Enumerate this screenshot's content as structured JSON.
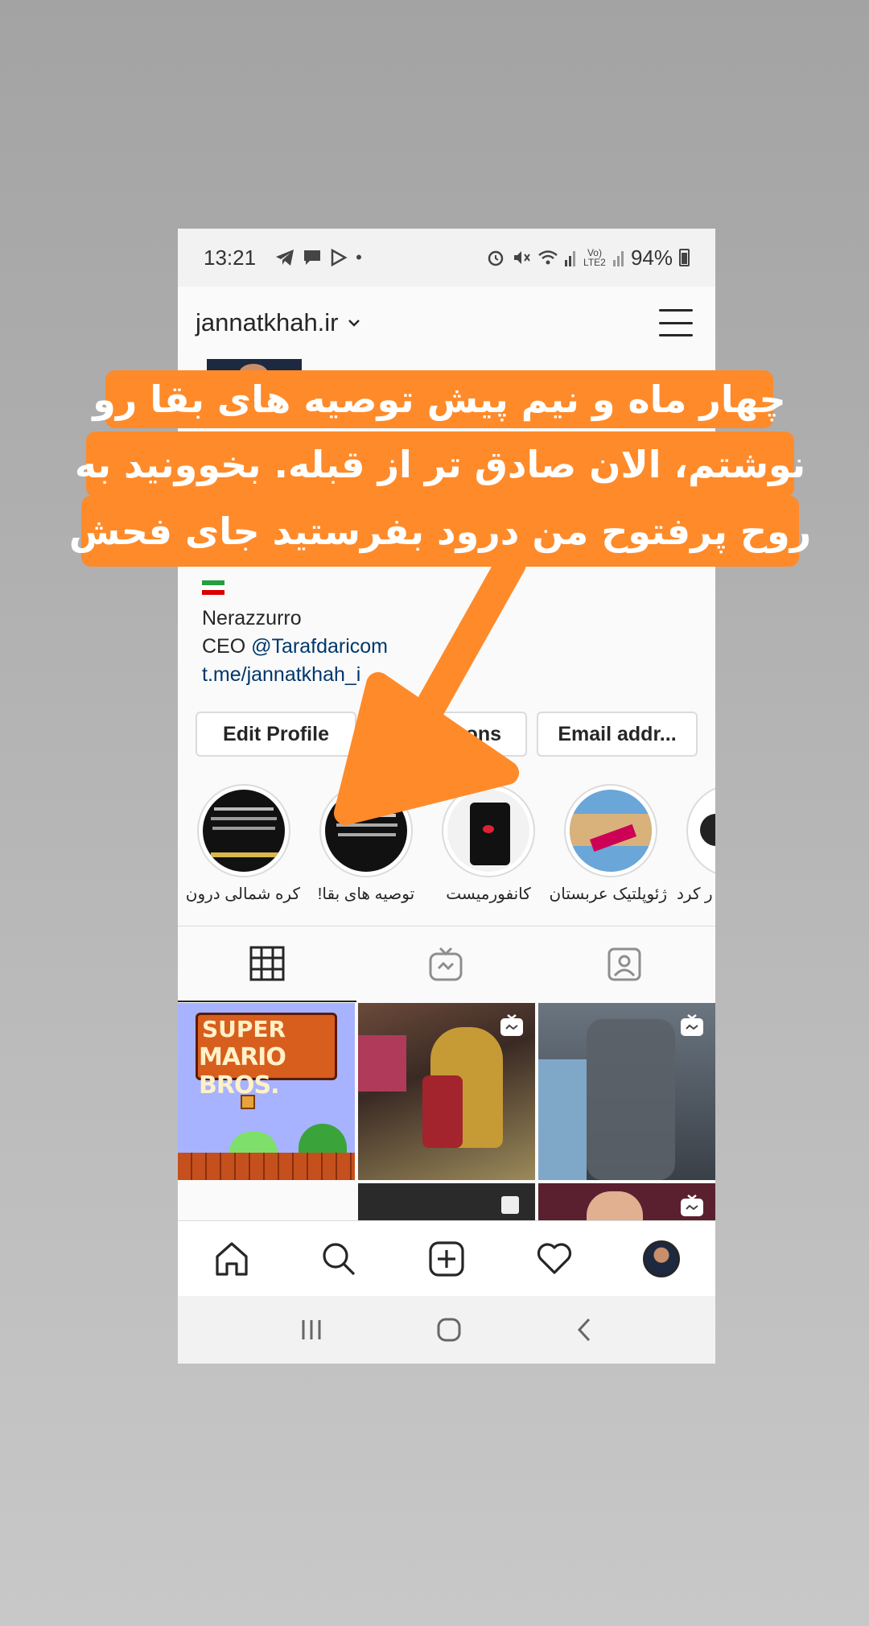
{
  "status_bar": {
    "time": "13:21",
    "battery": "94%",
    "lte": "Vo) LTE2"
  },
  "header": {
    "username": "jannatkhah.ir"
  },
  "bio": {
    "line1": "Nerazzurro",
    "line2_prefix": "CEO ",
    "line2_link": "@Tarafdaricom",
    "line3": "t.me/jannatkhah_i"
  },
  "buttons": {
    "edit_profile": "Edit Profile",
    "promotions": "ons",
    "email": "Email addr..."
  },
  "highlights": [
    {
      "label": "کره شمالی درون"
    },
    {
      "label": "توصیه های بقا!"
    },
    {
      "label": "کانفورمیست"
    },
    {
      "label": "ژئوپلتیک عربستان"
    },
    {
      "label": "ر کرد"
    }
  ],
  "grid": {
    "post1_text_line1": "SUPER",
    "post1_text_line2": "MARIO BROS."
  },
  "overlay": {
    "line1": "چهار ماه و نیم پیش توصیه های بقا رو",
    "line2": "نوشتم، الان صادق تر از قبله. بخوونید به",
    "line3": "روح پرفتوح من درود بفرستید جای فحش",
    "color": "#ff8a2a"
  }
}
